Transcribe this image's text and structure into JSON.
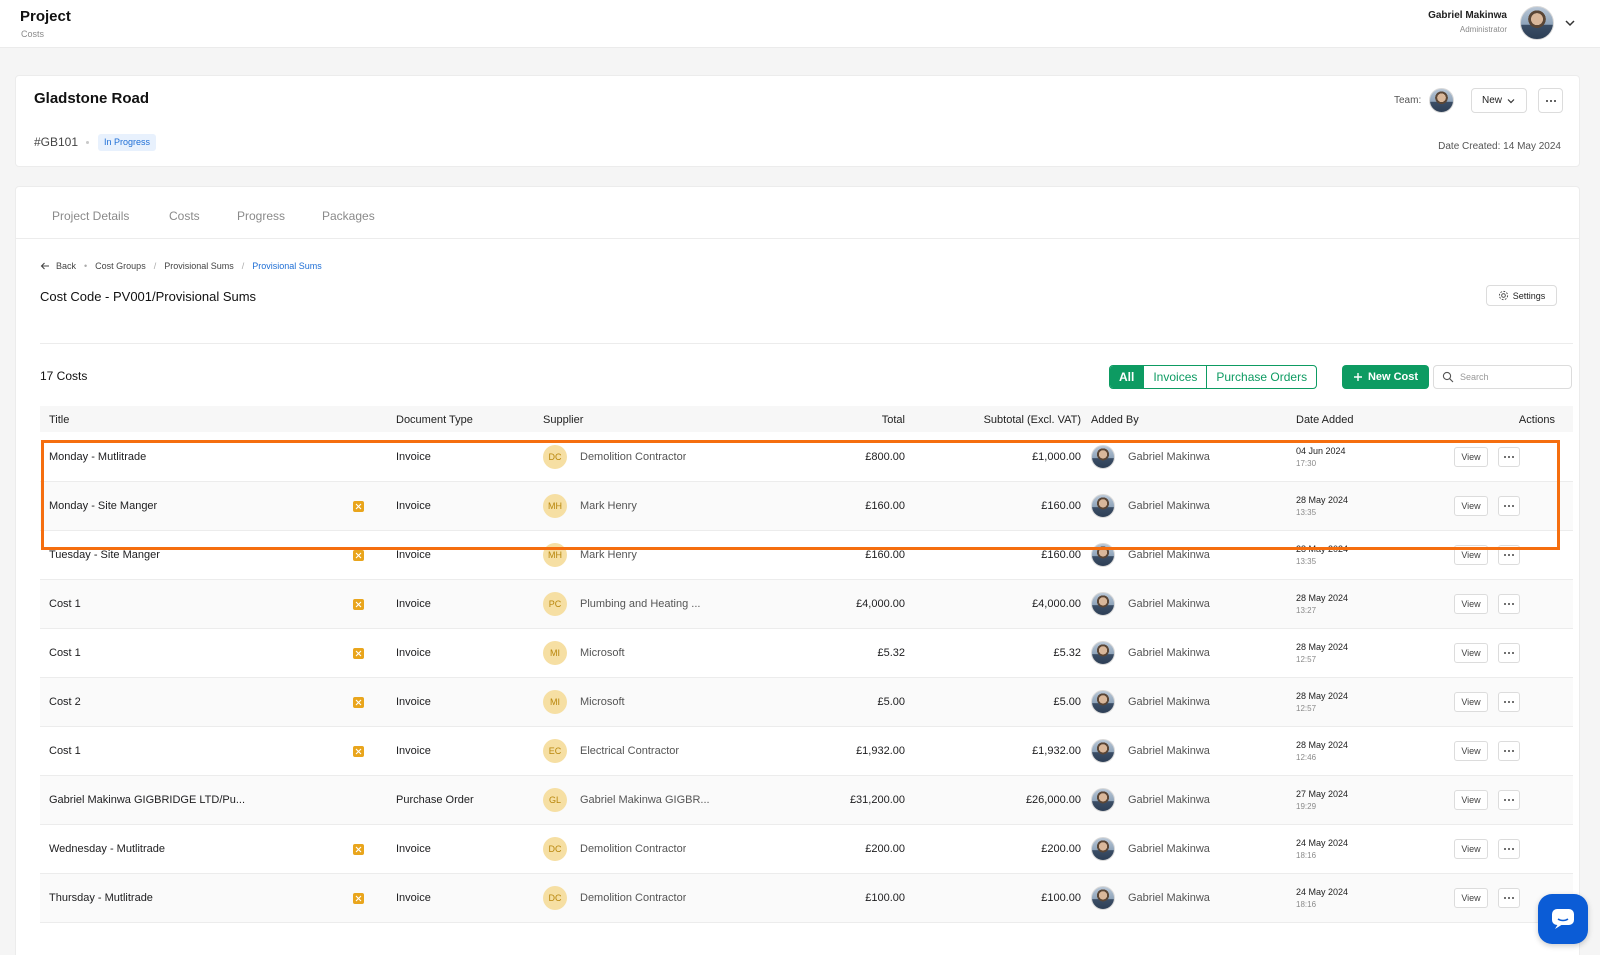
{
  "app": {
    "title": "Project",
    "subtitle": "Costs"
  },
  "user": {
    "name": "Gabriel Makinwa",
    "role": "Administrator"
  },
  "project": {
    "name": "Gladstone Road",
    "code": "#GB101",
    "status": "In Progress",
    "team_label": "Team:",
    "new_label": "New",
    "date_created": "Date Created: 14 May 2024"
  },
  "tabs": [
    "Project Details",
    "Costs",
    "Progress",
    "Packages"
  ],
  "breadcrumb": {
    "back": "Back",
    "items": [
      "Cost Groups",
      "Provisional Sums",
      "Provisional Sums"
    ]
  },
  "cost_code_title": "Cost Code - PV001/Provisional Sums",
  "settings_label": "Settings",
  "costs_count": "17 Costs",
  "filters": [
    "All",
    "Invoices",
    "Purchase Orders"
  ],
  "new_cost_label": "New Cost",
  "search_placeholder": "Search",
  "columns": [
    "Title",
    "Document Type",
    "Supplier",
    "Total",
    "Subtotal (Excl. VAT)",
    "Added By",
    "Date Added",
    "Actions"
  ],
  "view_label": "View",
  "rows": [
    {
      "title": "Monday - Mutlitrade",
      "flag": false,
      "doc": "Invoice",
      "sup_initials": "DC",
      "supplier": "Demolition Contractor",
      "total": "£800.00",
      "subtotal": "£1,000.00",
      "added_by": "Gabriel Makinwa",
      "date": "04 Jun 2024",
      "time": "17:30"
    },
    {
      "title": "Monday - Site Manger",
      "flag": true,
      "doc": "Invoice",
      "sup_initials": "MH",
      "supplier": "Mark Henry",
      "total": "£160.00",
      "subtotal": "£160.00",
      "added_by": "Gabriel Makinwa",
      "date": "28 May 2024",
      "time": "13:35"
    },
    {
      "title": "Tuesday - Site Manger",
      "flag": true,
      "doc": "Invoice",
      "sup_initials": "MH",
      "supplier": "Mark Henry",
      "total": "£160.00",
      "subtotal": "£160.00",
      "added_by": "Gabriel Makinwa",
      "date": "28 May 2024",
      "time": "13:35"
    },
    {
      "title": "Cost 1",
      "flag": true,
      "doc": "Invoice",
      "sup_initials": "PC",
      "supplier": "Plumbing and Heating ...",
      "total": "£4,000.00",
      "subtotal": "£4,000.00",
      "added_by": "Gabriel Makinwa",
      "date": "28 May 2024",
      "time": "13:27"
    },
    {
      "title": "Cost 1",
      "flag": true,
      "doc": "Invoice",
      "sup_initials": "MI",
      "supplier": "Microsoft",
      "total": "£5.32",
      "subtotal": "£5.32",
      "added_by": "Gabriel Makinwa",
      "date": "28 May 2024",
      "time": "12:57"
    },
    {
      "title": "Cost 2",
      "flag": true,
      "doc": "Invoice",
      "sup_initials": "MI",
      "supplier": "Microsoft",
      "total": "£5.00",
      "subtotal": "£5.00",
      "added_by": "Gabriel Makinwa",
      "date": "28 May 2024",
      "time": "12:57"
    },
    {
      "title": "Cost 1",
      "flag": true,
      "doc": "Invoice",
      "sup_initials": "EC",
      "supplier": "Electrical Contractor",
      "total": "£1,932.00",
      "subtotal": "£1,932.00",
      "added_by": "Gabriel Makinwa",
      "date": "28 May 2024",
      "time": "12:46"
    },
    {
      "title": "Gabriel Makinwa GIGBRIDGE LTD/Pu...",
      "flag": false,
      "doc": "Purchase Order",
      "sup_initials": "GL",
      "supplier": "Gabriel Makinwa GIGBR...",
      "total": "£31,200.00",
      "subtotal": "£26,000.00",
      "added_by": "Gabriel Makinwa",
      "date": "27 May 2024",
      "time": "19:29"
    },
    {
      "title": "Wednesday - Mutlitrade",
      "flag": true,
      "doc": "Invoice",
      "sup_initials": "DC",
      "supplier": "Demolition Contractor",
      "total": "£200.00",
      "subtotal": "£200.00",
      "added_by": "Gabriel Makinwa",
      "date": "24 May 2024",
      "time": "18:16"
    },
    {
      "title": "Thursday - Mutlitrade",
      "flag": true,
      "doc": "Invoice",
      "sup_initials": "DC",
      "supplier": "Demolition Contractor",
      "total": "£100.00",
      "subtotal": "£100.00",
      "added_by": "Gabriel Makinwa",
      "date": "24 May 2024",
      "time": "18:16"
    }
  ],
  "colors": {
    "accent": "#0d9b62",
    "highlight": "#f56e0f",
    "link": "#1f6fd6",
    "chat": "#0b5cd6"
  }
}
